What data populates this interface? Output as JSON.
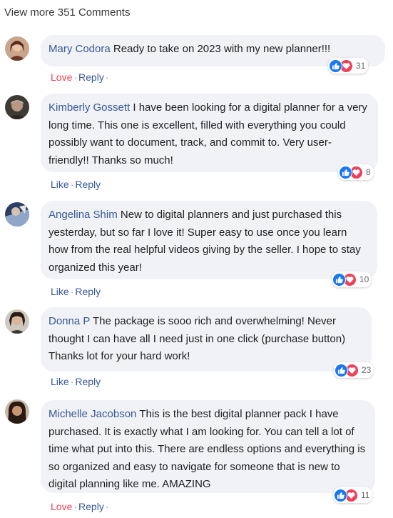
{
  "view_more_label": "View more 351 Comments",
  "comments": [
    {
      "author": "Mary Codora",
      "text": "Ready to take on 2023 with my new planner!!!",
      "reaction_count": "31",
      "action_1": "Love",
      "action_2": "Reply",
      "action_1_color": "#f33e58"
    },
    {
      "author": "Kimberly Gossett",
      "text": "I have been looking for a digital planner for a very long time. This one is excellent, filled with everything you could possibly want to document, track, and commit to. Very user-friendly!! Thanks so much!",
      "reaction_count": "8",
      "action_1": "Like",
      "action_2": "Reply",
      "action_1_color": "#385898"
    },
    {
      "author": "Angelina Shim",
      "text": "New to digital planners and just purchased this yesterday, but so far I love it! Super easy to use once you learn how from the real helpful videos giving by the seller. I hope to stay organized this year!",
      "reaction_count": "10",
      "action_1": "Like",
      "action_2": "Reply",
      "action_1_color": "#385898"
    },
    {
      "author": "Donna P",
      "text": "The package is sooo rich and overwhelming! Never thought I can have all I need just in one click (purchase button) Thanks lot for your hard work!",
      "reaction_count": "23",
      "action_1": "Like",
      "action_2": "Reply",
      "action_1_color": "#385898"
    },
    {
      "author": "Michelle Jacobson",
      "text": "This is the best digital planner pack I have purchased. It is exactly what I am looking for. You can tell a lot of time what put into this. There are endless options and everything is so organized and easy to navigate for someone that is new to digital planning like me. AMAZING",
      "reaction_count": "11",
      "action_1": "Love",
      "action_2": "Reply",
      "action_1_color": "#f33e58"
    }
  ],
  "icons": {
    "like": "thumbs-up-icon",
    "love": "heart-icon",
    "avatar": "avatar"
  },
  "colors": {
    "author": "#385898",
    "like_blue": "#1877f2",
    "love_red": "#f33e58",
    "bubble_bg": "#f0f2f5"
  }
}
